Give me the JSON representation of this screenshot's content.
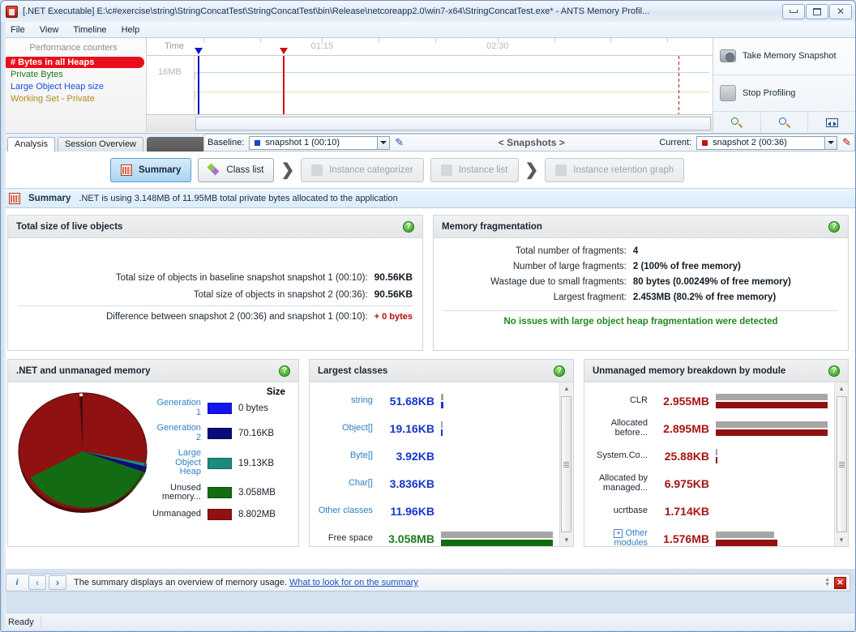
{
  "window": {
    "title": "[.NET Executable] E:\\c#exercise\\string\\StringConcatTest\\StringConcatTest\\bin\\Release\\netcoreapp2.0\\win7-x64\\StringConcatTest.exe* - ANTS Memory Profil...",
    "minimize": "minimize-button",
    "maximize": "maximize-button",
    "close": "✕"
  },
  "menu": [
    {
      "label": "File"
    },
    {
      "label": "View"
    },
    {
      "label": "Timeline"
    },
    {
      "label": "Help"
    }
  ],
  "counters": {
    "header": "Performance counters",
    "items": [
      {
        "label": "# Bytes in all Heaps",
        "selected": true,
        "color": "#ffffff"
      },
      {
        "label": "Private Bytes",
        "selected": false,
        "color": "#1a7a1a"
      },
      {
        "label": "Large Object Heap size",
        "selected": false,
        "color": "#1c4fd8"
      },
      {
        "label": "Working Set - Private",
        "selected": false,
        "color": "#b08b1a"
      }
    ]
  },
  "timeline": {
    "time_label": "Time",
    "y_label": "16MB",
    "ticks": [
      {
        "label": "01:15",
        "pos_pct": 31
      },
      {
        "label": "02:30",
        "pos_pct": 62
      }
    ],
    "markers": [
      {
        "name": "baseline-marker",
        "color": "#0b18c8",
        "pos_pct": 9
      },
      {
        "name": "current-marker",
        "color": "#d40a0a",
        "pos_pct": 24
      },
      {
        "name": "live-marker",
        "color": "#d40a0a",
        "pos_pct": 94
      }
    ]
  },
  "actions": {
    "take_snapshot": "Take Memory Snapshot",
    "stop_profiling": "Stop Profiling",
    "zoom_in": "zoom-in",
    "zoom_out": "zoom-out",
    "zoom_fit": "zoom-fit"
  },
  "tabs": [
    {
      "label": "Analysis",
      "active": true
    },
    {
      "label": "Session Overview",
      "active": false
    }
  ],
  "snapbar": {
    "baseline_label": "Baseline:",
    "baseline_value": "snapshot 1 (00:10)",
    "baseline_color": "#1645c8",
    "snapshots_label": "< Snapshots >",
    "current_label": "Current:",
    "current_value": "snapshot 2 (00:36)",
    "current_color": "#c41111",
    "edit_icon": "✎"
  },
  "nav": [
    {
      "label": "Summary",
      "state": "selected"
    },
    {
      "label": "Class list",
      "state": "enabled"
    },
    {
      "label": "Instance categorizer",
      "state": "disabled"
    },
    {
      "label": "Instance list",
      "state": "enabled-grey"
    },
    {
      "label": "Instance retention graph",
      "state": "disabled"
    }
  ],
  "banner": {
    "title": "Summary",
    "text": ".NET is using 3.148MB of 11.95MB total private bytes allocated to the application"
  },
  "live_objects": {
    "title": "Total size of live objects",
    "rows": [
      {
        "k": "Total size of objects in baseline snapshot snapshot 1 (00:10):",
        "v": "90.56KB"
      },
      {
        "k": "Total size of objects in snapshot 2 (00:36):",
        "v": "90.56KB"
      }
    ],
    "diff_label": "Difference between snapshot 2 (00:36) and snapshot 1 (00:10):",
    "diff_value": "+ 0 bytes"
  },
  "fragmentation": {
    "title": "Memory fragmentation",
    "rows": [
      {
        "k": "Total number of fragments:",
        "v": "4"
      },
      {
        "k": "Number of large fragments:",
        "v": "2 (100% of free memory)"
      },
      {
        "k": "Wastage due to small fragments:",
        "v": "80 bytes (0.00249% of free memory)"
      },
      {
        "k": "Largest fragment:",
        "v": "2.453MB (80.2% of free memory)"
      }
    ],
    "note": "No issues with large object heap fragmentation were detected"
  },
  "memory_pie": {
    "title": ".NET and unmanaged memory",
    "size_header": "Size",
    "legend": [
      {
        "label": "Generation 1",
        "value": "0 bytes",
        "color": "#1414f0"
      },
      {
        "label": "Generation 2",
        "value": "70.16KB",
        "color": "#0b0b7a"
      },
      {
        "label": "Large Object Heap",
        "value": "19.13KB",
        "color": "#1d8a80"
      },
      {
        "label": "Unused memory...",
        "value": "3.058MB",
        "color": "#136b13"
      },
      {
        "label": "Unmanaged",
        "value": "8.802MB",
        "color": "#8f1111"
      }
    ]
  },
  "largest_classes": {
    "title": "Largest classes",
    "rows": [
      {
        "name": "string",
        "value": "51.68KB",
        "bar_pct": 1.5,
        "style": "blue"
      },
      {
        "name": "Object[]",
        "value": "19.16KB",
        "bar_pct": 1.0,
        "style": "blue"
      },
      {
        "name": "Byte[]",
        "value": "3.92KB",
        "bar_pct": 0,
        "style": "blue"
      },
      {
        "name": "Char[]",
        "value": "3.836KB",
        "bar_pct": 0,
        "style": "blue"
      },
      {
        "name": "Other classes",
        "value": "11.96KB",
        "bar_pct": 0,
        "style": "blue"
      },
      {
        "name": "Free space",
        "value": "3.058MB",
        "bar_pct": 100,
        "style": "green"
      }
    ]
  },
  "unmanaged_modules": {
    "title": "Unmanaged memory breakdown by module",
    "rows": [
      {
        "name": "CLR",
        "value": "2.955MB",
        "bar_pct": 100,
        "expandable": false
      },
      {
        "name": "Allocated before...",
        "value": "2.895MB",
        "bar_pct": 100,
        "expandable": false
      },
      {
        "name": "System.Co...",
        "value": "25.88KB",
        "bar_pct": 1,
        "expandable": false
      },
      {
        "name": "Allocated by managed...",
        "value": "6.975KB",
        "bar_pct": 0,
        "expandable": false
      },
      {
        "name": "ucrtbase",
        "value": "1.714KB",
        "bar_pct": 0,
        "expandable": false
      },
      {
        "name": "Other modules",
        "value": "1.576MB",
        "bar_pct": 52,
        "expandable": true
      }
    ]
  },
  "infobar": {
    "text": "The summary displays an overview of memory usage.",
    "link": "What to look for on the summary",
    "back": "‹",
    "forward": "›",
    "info": "i",
    "close": "✕"
  },
  "statusbar": {
    "text": "Ready"
  },
  "chart_data": {
    "type": "pie",
    "title": ".NET and unmanaged memory",
    "labels": [
      "Generation 1",
      "Generation 2",
      "Large Object Heap",
      "Unused memory...",
      "Unmanaged"
    ],
    "values_text": [
      "0 bytes",
      "70.16KB",
      "19.13KB",
      "3.058MB",
      "8.802MB"
    ],
    "values_bytes": [
      0,
      71844,
      19589,
      3206545,
      9229794
    ],
    "colors": [
      "#1414f0",
      "#0b0b7a",
      "#1d8a80",
      "#136b13",
      "#8f1111"
    ],
    "legend": "right"
  }
}
